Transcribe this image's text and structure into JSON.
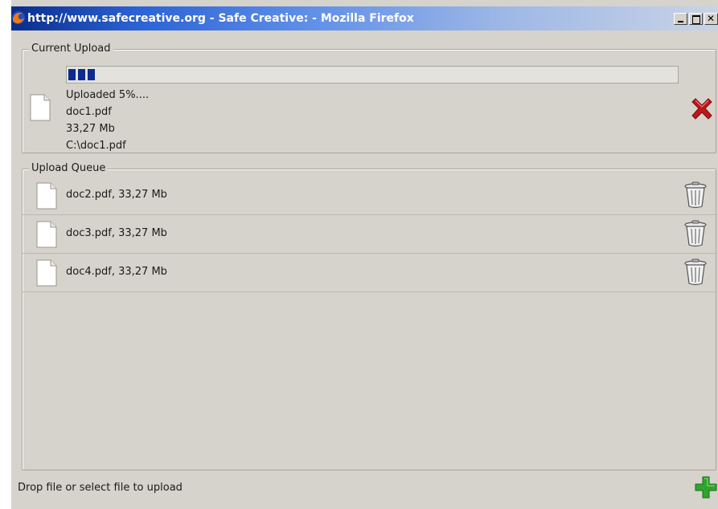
{
  "window": {
    "title": "http://www.safecreative.org - Safe Creative: - Mozilla Firefox",
    "titlebar_color": "#2b63d6"
  },
  "current_upload": {
    "legend": "Current Upload",
    "progress_percent": 5,
    "status": "Uploaded 5%....",
    "file_name": "doc1.pdf",
    "file_size": "33,27 Mb",
    "file_path": "C:\\doc1.pdf",
    "cancel_icon": "red-x-icon"
  },
  "upload_queue": {
    "legend": "Upload Queue",
    "items": [
      {
        "label": "doc2.pdf, 33,27 Mb",
        "icon": "trash-icon"
      },
      {
        "label": "doc3.pdf, 33,27 Mb",
        "icon": "trash-icon"
      },
      {
        "label": "doc4.pdf, 33,27 Mb",
        "icon": "trash-icon"
      }
    ]
  },
  "footer": {
    "hint": "Drop file or select file to upload",
    "add_icon": "green-plus-icon"
  },
  "colors": {
    "panel_bg": "#d6d3cc",
    "progress_fill": "#0d2a8f",
    "cancel_red": "#c0161c",
    "add_green": "#2fa52c"
  }
}
